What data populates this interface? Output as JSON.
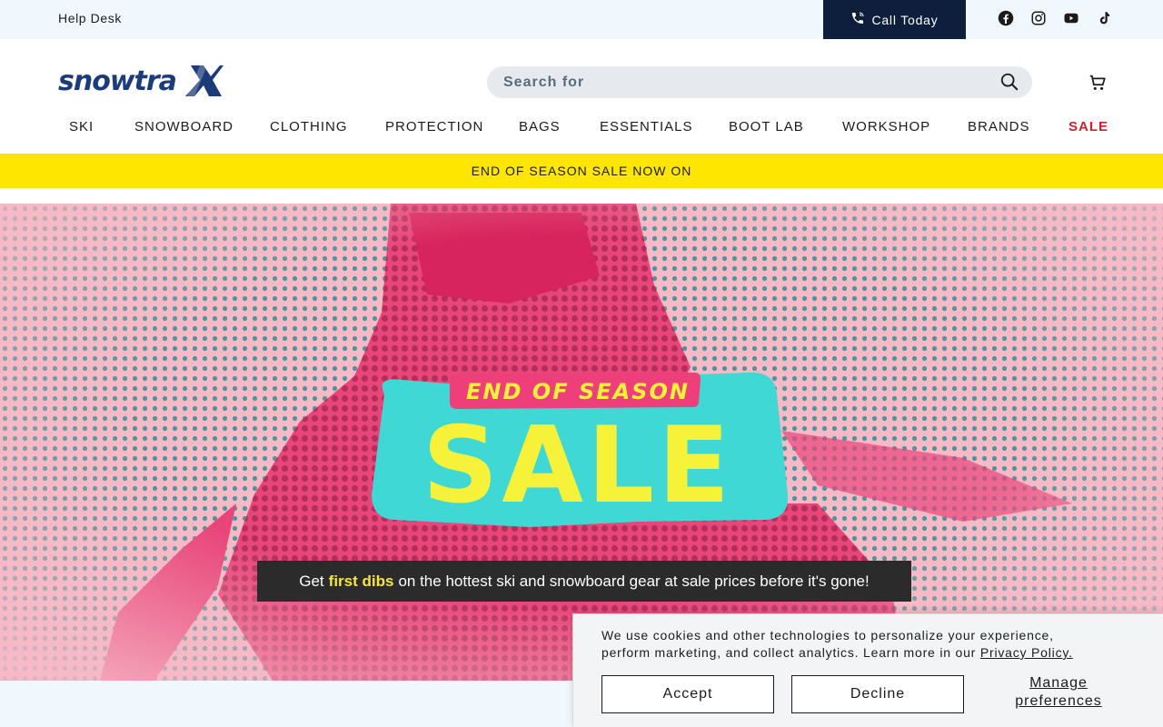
{
  "topbar": {
    "help_desk": "Help Desk",
    "call_label": "Call Today",
    "socials": [
      "facebook-icon",
      "instagram-icon",
      "youtube-icon",
      "tiktok-icon"
    ]
  },
  "header": {
    "logo_text": "snowtrax",
    "search_placeholder": "Search for",
    "cart_icon": "cart-icon"
  },
  "nav": {
    "items": [
      "SKI",
      "SNOWBOARD",
      "CLOTHING",
      "PROTECTION",
      "BAGS",
      "ESSENTIALS",
      "BOOT LAB",
      "WORKSHOP",
      "BRANDS",
      "SALE"
    ]
  },
  "promo": {
    "text": "END OF SEASON SALE NOW ON"
  },
  "hero": {
    "kicker": "END OF SEASON",
    "headline": "SALE",
    "caption_before": "Get",
    "caption_highlight": "first dibs",
    "caption_after": "on the hottest ski and snowboard gear at sale prices before it's gone!"
  },
  "cookie": {
    "text_line1": "We use cookies and other technologies to personalize your experience,",
    "text_line2": "perform marketing, and collect analytics. Learn more in our",
    "policy_link": "Privacy Policy.",
    "accept": "Accept",
    "decline": "Decline",
    "manage": "Manage preferences"
  },
  "colors": {
    "topbar_bg": "#f0f7fd",
    "call_bg": "#0d1f3c",
    "promo_bg": "#ffe600",
    "sale_red": "#d0212b",
    "hero_pink": "#f6b9c6",
    "badge_cyan": "#3fd8d4",
    "badge_yellow": "#f6f23a"
  }
}
